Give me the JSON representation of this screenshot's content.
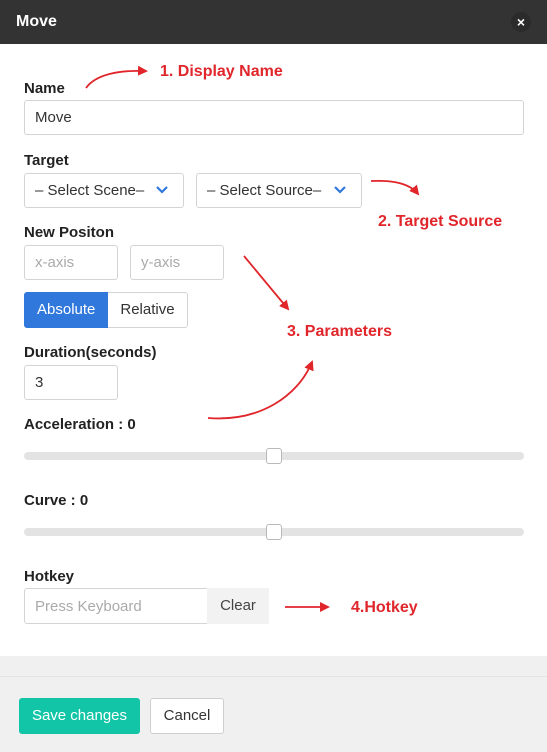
{
  "dialog": {
    "title": "Move",
    "close_icon": "close-icon"
  },
  "name": {
    "label": "Name",
    "value": "Move"
  },
  "target": {
    "label": "Target",
    "scene_select": {
      "value": "– Select Scene–"
    },
    "source_select": {
      "value": "– Select Source–"
    }
  },
  "new_position": {
    "label": "New Positon",
    "x_placeholder": "x-axis",
    "y_placeholder": "y-axis",
    "mode_options": [
      "Absolute",
      "Relative"
    ],
    "mode_selected": "Absolute"
  },
  "duration": {
    "label": "Duration(seconds)",
    "value": "3"
  },
  "acceleration": {
    "label": "Acceleration : 0",
    "value": 0,
    "slider_fraction": 0.5
  },
  "curve": {
    "label": "Curve : 0",
    "value": 0,
    "slider_fraction": 0.5
  },
  "hotkey": {
    "label": "Hotkey",
    "placeholder": "Press Keyboard",
    "clear_label": "Clear"
  },
  "footer": {
    "save_label": "Save changes",
    "cancel_label": "Cancel"
  },
  "annotations": {
    "display_name": "1. Display Name",
    "target_source": "2. Target Source",
    "parameters": "3. Parameters",
    "hotkey": "4.Hotkey"
  },
  "colors": {
    "titlebar": "#333333",
    "primary": "#3078db",
    "save": "#12c5a6",
    "annotation": "#e0262b",
    "chevron": "#3078db"
  }
}
